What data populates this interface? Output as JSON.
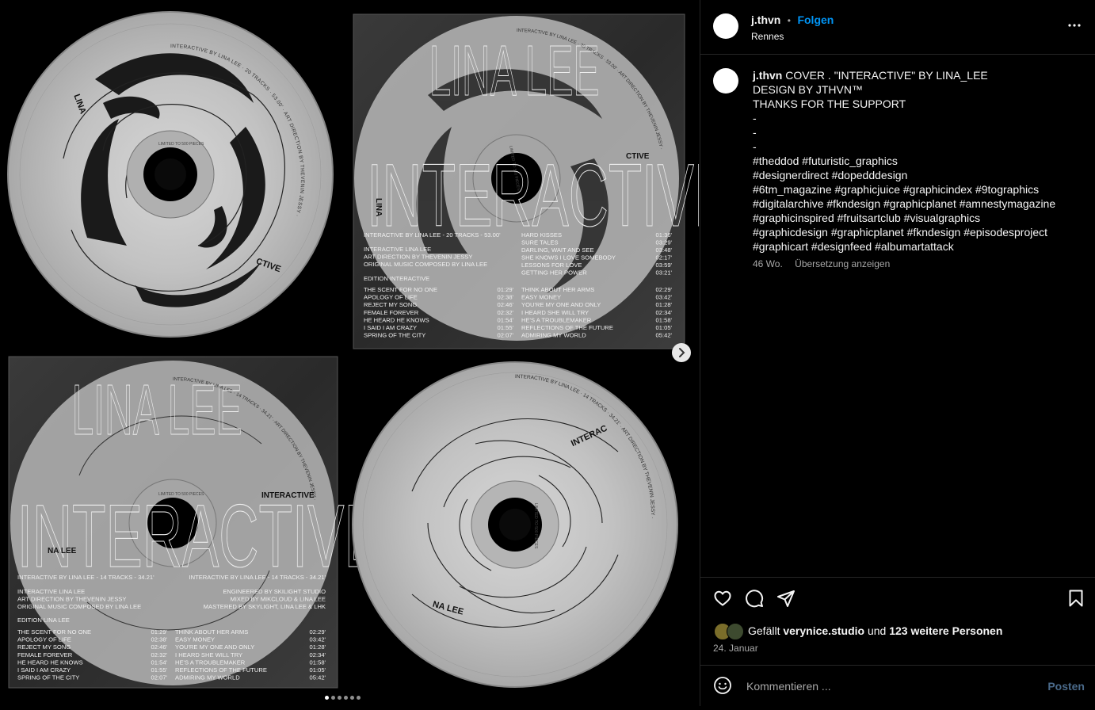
{
  "post": {
    "username": "j.thvn",
    "dot": "•",
    "follow_label": "Folgen",
    "location": "Rennes",
    "more_icon": "more-horizontal-icon"
  },
  "caption": {
    "username": "j.thvn",
    "lines": [
      "COVER . \"INTERACTIVE\" BY LINA_LEE",
      "DESIGN BY JTHVN™",
      "THANKS FOR THE SUPPORT",
      "-",
      "-",
      "-",
      "#theddod #futuristic_graphics",
      "#designerdirect #dopedddesign",
      "#6tm_magazine #graphicjuice #graphicindex #9tographics",
      "#digitalarchive #fkndesign #graphicplanet #amnestymagazine",
      "#graphicinspired #fruitsartclub #visualgraphics",
      "#graphicdesign #graphicplanet #fkndesign #episodesproject",
      "#graphicart #designfeed #albumartattack"
    ],
    "age": "46 Wo.",
    "translate_label": "Übersetzung anzeigen"
  },
  "likes": {
    "prefix": "Gefällt ",
    "user": "verynice.studio",
    "middle": " und ",
    "others": "123 weitere Personen"
  },
  "date": "24. Januar",
  "comment": {
    "placeholder": "Kommentieren ...",
    "post_label": "Posten"
  },
  "artwork": {
    "title_top": "LINA LEE",
    "title_main": "INTERACTIVE",
    "disc_text_a": "INTERACTIVE BY LINA LEE · 20 TRACKS · 53.00' · ART DIRECTION BY THEVENIN JESSY ·",
    "disc_text_b": "INTERACTIVE BY LINA LEE · 14 TRACKS · 34.21' · ART DIRECTION BY THEVENIN JESSY ·",
    "limited": "LIMITED TO 500 PIECES",
    "cd1_label_side": "LINA",
    "cd1_label_bottom": "CTIVE",
    "cd4_label_top": "INTERAC",
    "cd4_label_bottom": "NA LEE",
    "sleeve1": {
      "header_left": "INTERACTIVE BY LINA LEE - 20 TRACKS - 53.00'",
      "credits": [
        "INTERACTIVE LINA LEE",
        "ART DIRECTION BY THEVENIN JESSY",
        "ORIGINAL MUSIC COMPOSED BY LINA LEE"
      ],
      "edition": "EDITION INTERACTIVE",
      "side_label": "CTIVE",
      "corner_label": "LINA",
      "tracks_a": [
        [
          "HARD KISSES",
          "01:36'"
        ],
        [
          "SURE TALES",
          "03:29'"
        ],
        [
          "DARLING, WAIT AND SEE",
          "03:48'"
        ],
        [
          "SHE KNOWS I LOVE SOMEBODY",
          "02:17'"
        ],
        [
          "LESSONS FOR LOVE",
          "03:59'"
        ],
        [
          "GETTING HER POWER",
          "03:21'"
        ]
      ],
      "tracks_b": [
        [
          "THE SCENT FOR NO ONE",
          "01:29'",
          "THINK ABOUT HER ARMS",
          "02:29'"
        ],
        [
          "APOLOGY OF LIFE",
          "02:38'",
          "EASY MONEY",
          "03:42'"
        ],
        [
          "REJECT MY SONG",
          "02:46'",
          "YOU'RE MY ONE AND ONLY",
          "01:28'"
        ],
        [
          "FEMALE FOREVER",
          "02:32'",
          "I HEARD SHE WILL TRY",
          "02:34'"
        ],
        [
          "HE HEARD HE KNOWS",
          "01:54'",
          "HE'S A TROUBLEMAKER",
          "01:58'"
        ],
        [
          "I SAID I AM CRAZY",
          "01:55'",
          "REFLECTIONS OF THE FUTURE",
          "01:05'"
        ],
        [
          "SPRING OF THE CITY",
          "02:07'",
          "ADMIRING MY WORLD",
          "05:42'"
        ]
      ]
    },
    "sleeve2": {
      "header_left": "INTERACTIVE BY LINA LEE - 14 TRACKS - 34.21'",
      "header_right": "INTERACTIVE BY LINA LEE - 14 TRACKS - 34.21'",
      "credits_left": [
        "INTERACTIVE LINA LEE",
        "ART DIRECTION BY THEVENIN JESSY",
        "ORIGINAL MUSIC COMPOSED BY LINA LEE"
      ],
      "credits_right": [
        "ENGINEERED BY SKILIGHT STUDIO",
        "MIXED BY MIKCLOUD & LINA LEE",
        "MASTERED BY SKYLIGHT, LINA LEE & LHK"
      ],
      "edition": "EDITION LINA LEE",
      "side_label": "INTERACTIVE",
      "corner_label": "NA LEE",
      "tracks": [
        [
          "THE SCENT FOR NO ONE",
          "01:29'",
          "THINK ABOUT HER ARMS",
          "02:29'"
        ],
        [
          "APOLOGY OF LIFE",
          "02:38'",
          "EASY MONEY",
          "03:42'"
        ],
        [
          "REJECT MY SONG",
          "02:46'",
          "YOU'RE MY ONE AND ONLY",
          "01:28'"
        ],
        [
          "FEMALE FOREVER",
          "02:32'",
          "I HEARD SHE WILL TRY",
          "02:34'"
        ],
        [
          "HE HEARD HE KNOWS",
          "01:54'",
          "HE'S A TROUBLEMAKER",
          "01:58'"
        ],
        [
          "I SAID I AM CRAZY",
          "01:55'",
          "REFLECTIONS OF THE FUTURE",
          "01:05'"
        ],
        [
          "SPRING OF THE CITY",
          "02:07'",
          "ADMIRING MY WORLD",
          "05:42'"
        ]
      ]
    }
  },
  "carousel": {
    "slide_count": 6,
    "active_index": 0
  },
  "icons": {
    "like": "heart-icon",
    "comment": "comment-icon",
    "share": "send-icon",
    "save": "bookmark-icon",
    "emoji": "emoji-icon",
    "next": "chevron-right-icon"
  }
}
